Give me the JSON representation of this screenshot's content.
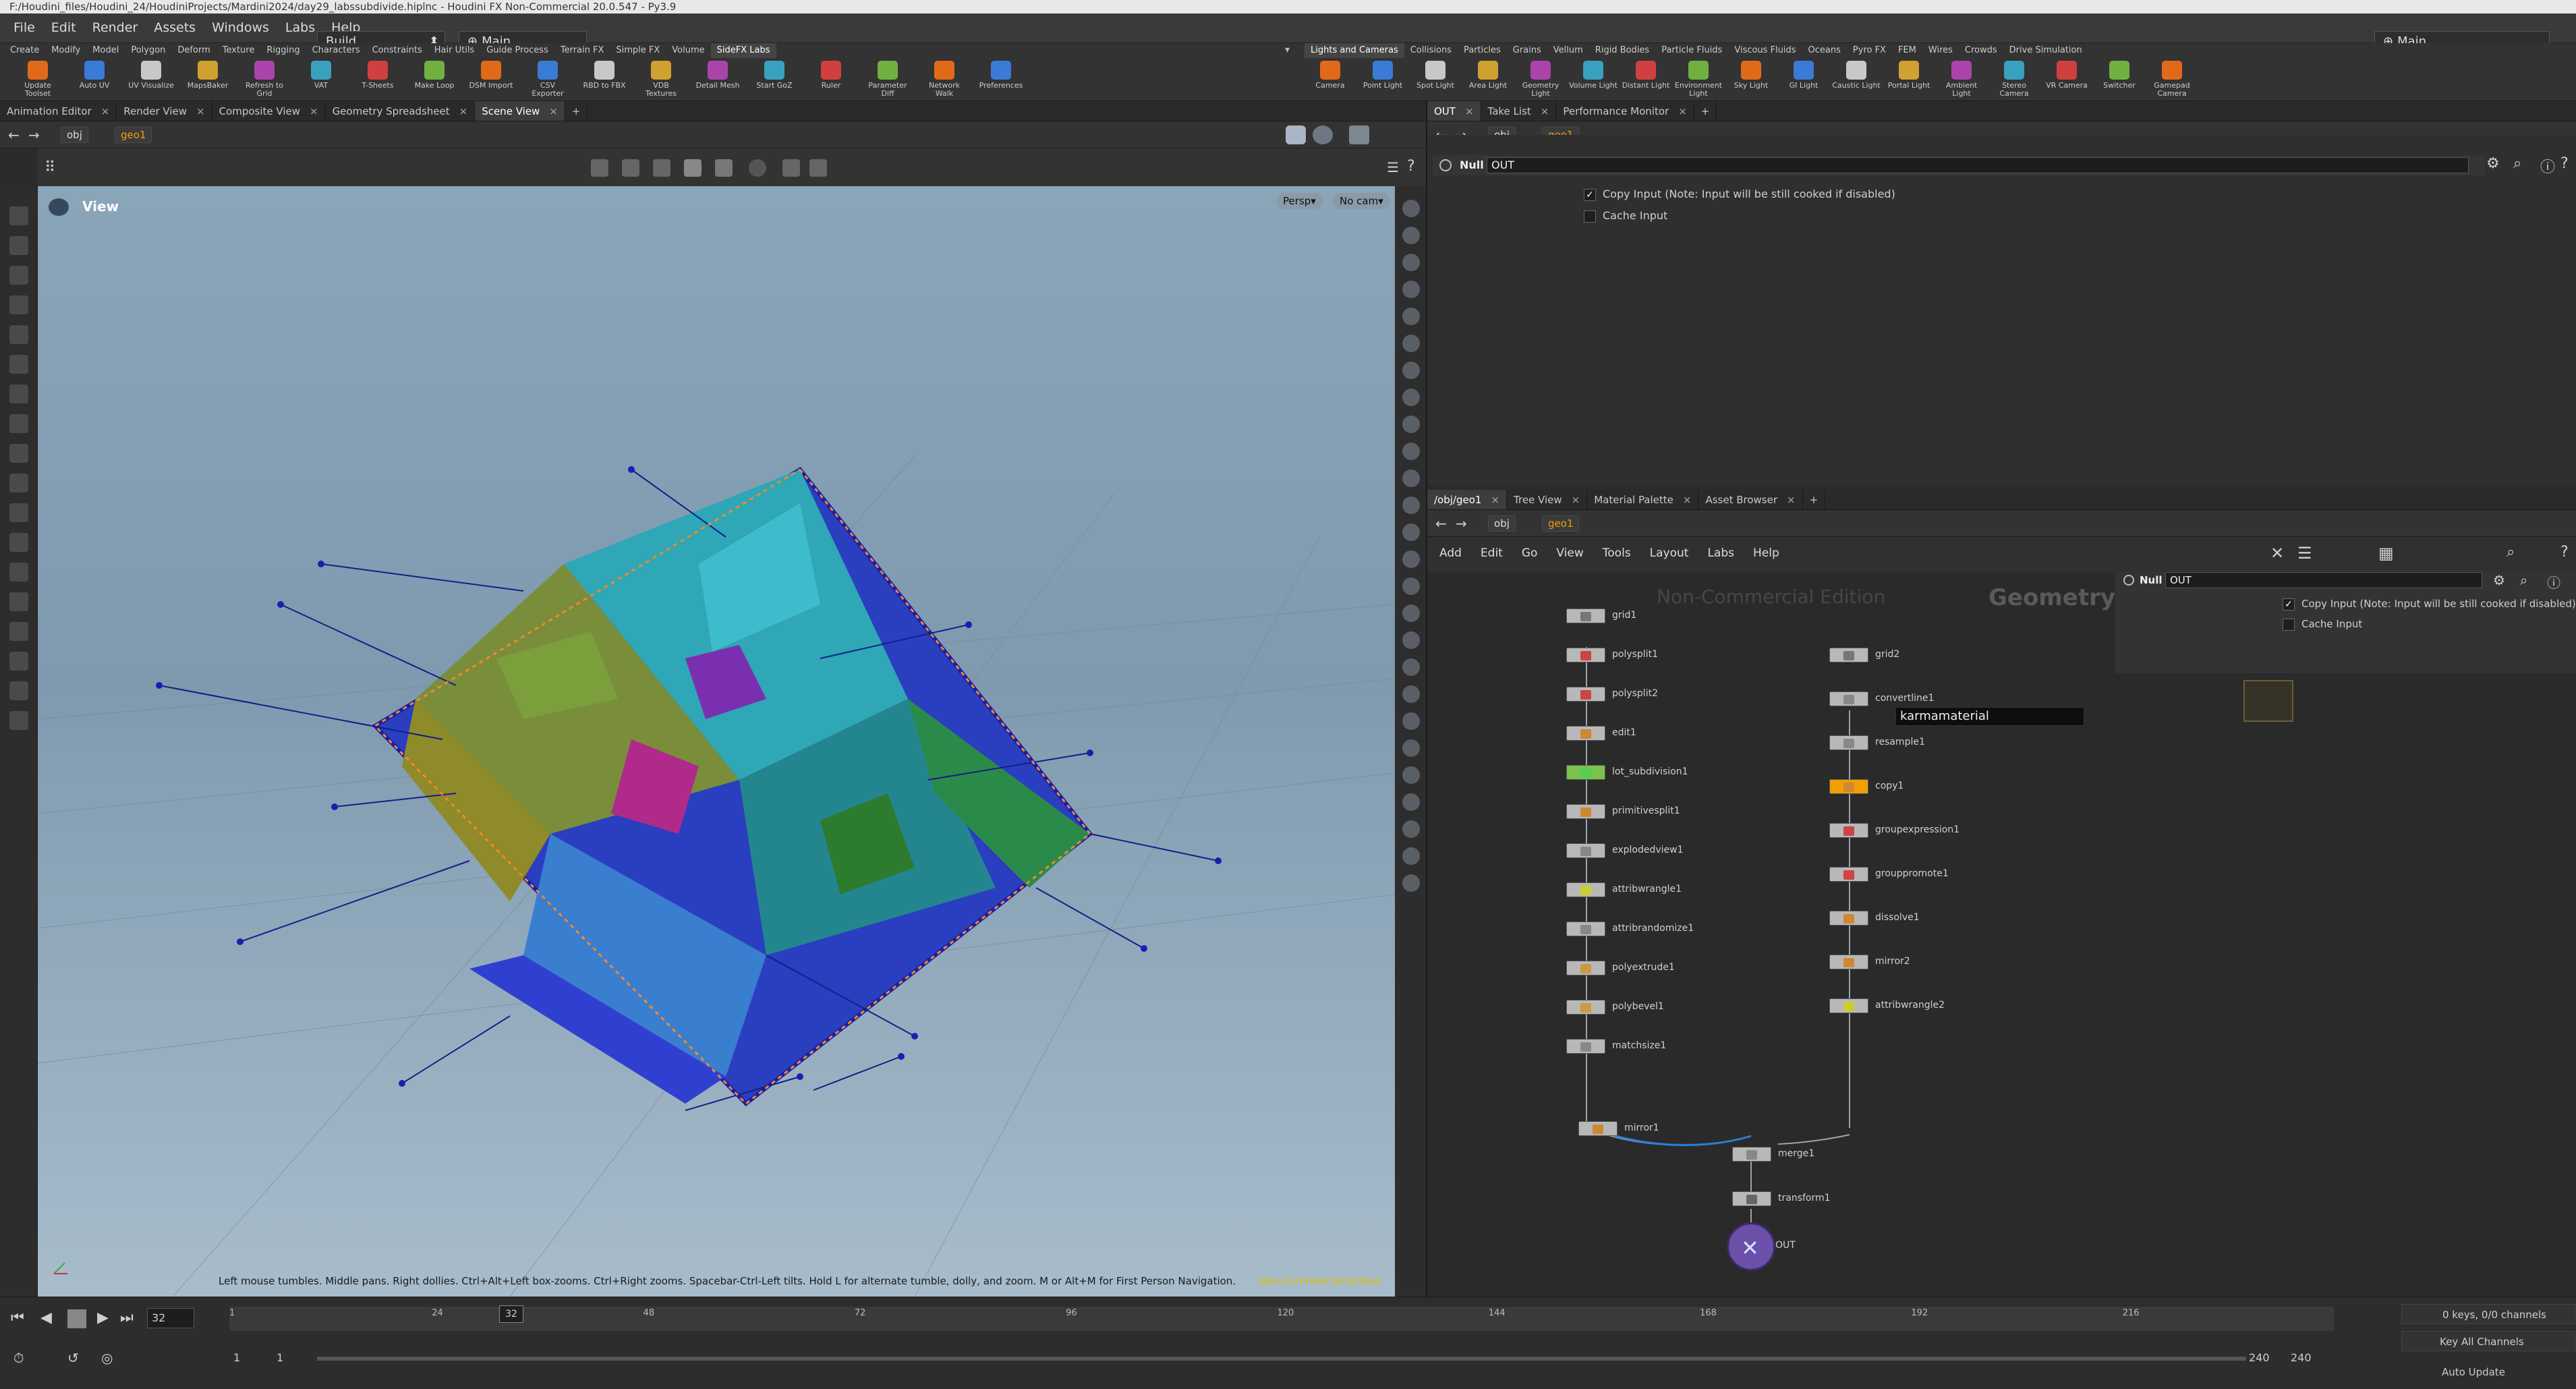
{
  "window": {
    "title": "F:/Houdini_files/Houdini_24/HoudiniProjects/Mardini2024/day29_labssubdivide.hiplnc - Houdini FX Non-Commercial 20.0.547 - Py3.9"
  },
  "menubar": {
    "items": [
      "File",
      "Edit",
      "Render",
      "Assets",
      "Windows",
      "Labs",
      "Help"
    ],
    "desktop": "Build",
    "context": "Main",
    "right_context": "Main"
  },
  "shelf_left": {
    "tabs": [
      "Create",
      "Modify",
      "Model",
      "Polygon",
      "Deform",
      "Texture",
      "Rigging",
      "Characters",
      "Constraints",
      "Hair Utils",
      "Guide Process",
      "Terrain FX",
      "Simple FX",
      "Volume",
      "SideFX Labs"
    ],
    "active_tab": "SideFX Labs",
    "tools": [
      "Update Toolset",
      "Auto UV",
      "UV Visualize",
      "MapsBaker",
      "Refresh to Grid",
      "VAT",
      "T-Sheets",
      "Make Loop",
      "DSM Import",
      "CSV Exporter",
      "RBD to FBX",
      "VDB Textures",
      "Detail Mesh",
      "Start GoZ",
      "Ruler",
      "Parameter Diff",
      "Network Walk",
      "Preferences"
    ]
  },
  "shelf_right": {
    "tabs": [
      "Lights and Cameras",
      "Collisions",
      "Particles",
      "Grains",
      "Vellum",
      "Rigid Bodies",
      "Particle Fluids",
      "Viscous Fluids",
      "Oceans",
      "Pyro FX",
      "FEM",
      "Wires",
      "Crowds",
      "Drive Simulation"
    ],
    "active_tab": "Lights and Cameras",
    "tools": [
      "Camera",
      "Point Light",
      "Spot Light",
      "Area Light",
      "Geometry Light",
      "Volume Light",
      "Distant Light",
      "Environment Light",
      "Sky Light",
      "GI Light",
      "Caustic Light",
      "Portal Light",
      "Ambient Light",
      "Stereo Camera",
      "VR Camera",
      "Switcher",
      "Gamepad Camera"
    ]
  },
  "left_pane": {
    "tabs": [
      "Animation Editor",
      "Render View",
      "Composite View",
      "Geometry Spreadsheet",
      "Scene View"
    ],
    "active_tab": "Scene View",
    "path": [
      "obj",
      "geo1"
    ],
    "viewport": {
      "label": "View",
      "persp": "Persp",
      "cam": "No cam",
      "status": "Left mouse tumbles. Middle pans. Right dollies. Ctrl+Alt+Left box-zooms. Ctrl+Right zooms. Spacebar-Ctrl-Left tilts. Hold L for alternate tumble, dolly, and zoom. M or Alt+M for First Person Navigation.",
      "watermark": "Non-Commercial Edition"
    }
  },
  "param_pane": {
    "tabs": [
      "OUT",
      "Take List",
      "Performance Monitor"
    ],
    "path": [
      "obj",
      "geo1"
    ],
    "node_type": "Null",
    "node_name": "OUT",
    "params": [
      {
        "label": "Copy Input (Note: Input will be still cooked if disabled)",
        "checked": true
      },
      {
        "label": "Cache Input",
        "checked": false
      }
    ]
  },
  "network_pane": {
    "tabs": [
      "/obj/geo1",
      "Tree View",
      "Material Palette",
      "Asset Browser"
    ],
    "path": [
      "obj",
      "geo1"
    ],
    "menu": [
      "Add",
      "Edit",
      "Go",
      "View",
      "Tools",
      "Layout",
      "Labs",
      "Help"
    ],
    "watermark": "Non-Commercial Edition",
    "context_label": "Geometry",
    "search_text": "karmamaterial",
    "inline_params": {
      "node_type": "Null",
      "node_name": "OUT",
      "params": [
        {
          "label": "Copy Input (Note: Input will be still cooked if disabled)",
          "checked": true
        },
        {
          "label": "Cache Input",
          "checked": false
        }
      ]
    },
    "nodes_left": [
      "grid1",
      "polysplit1",
      "polysplit2",
      "edit1",
      "lot_subdivision1",
      "primitivesplit1",
      "explodedview1",
      "attribwrangle1",
      "attribrandomize1",
      "polyextrude1",
      "polybevel1",
      "matchsize1",
      "mirror1"
    ],
    "nodes_right": [
      "grid2",
      "convertline1",
      "resample1",
      "copy1",
      "groupexpression1",
      "grouppromote1",
      "dissolve1",
      "mirror2",
      "attribwrangle2"
    ],
    "nodes_bottom": [
      "merge1",
      "transform1",
      "OUT"
    ]
  },
  "timeline": {
    "current_frame": "32",
    "ticks": [
      "1",
      "24",
      "48",
      "72",
      "96",
      "120",
      "144",
      "168",
      "192",
      "216"
    ],
    "playhead_label": "32",
    "range_start": "1",
    "range_start2": "1",
    "range_end": "240",
    "range_end2": "240",
    "keys": "0 keys, 0/0 channels",
    "key_all": "Key All Channels",
    "auto_update": "Auto Update"
  },
  "colors": {
    "accent": "#f0a000",
    "selected_blue": "#2a5fd8",
    "bg": "#2b2b2b"
  }
}
